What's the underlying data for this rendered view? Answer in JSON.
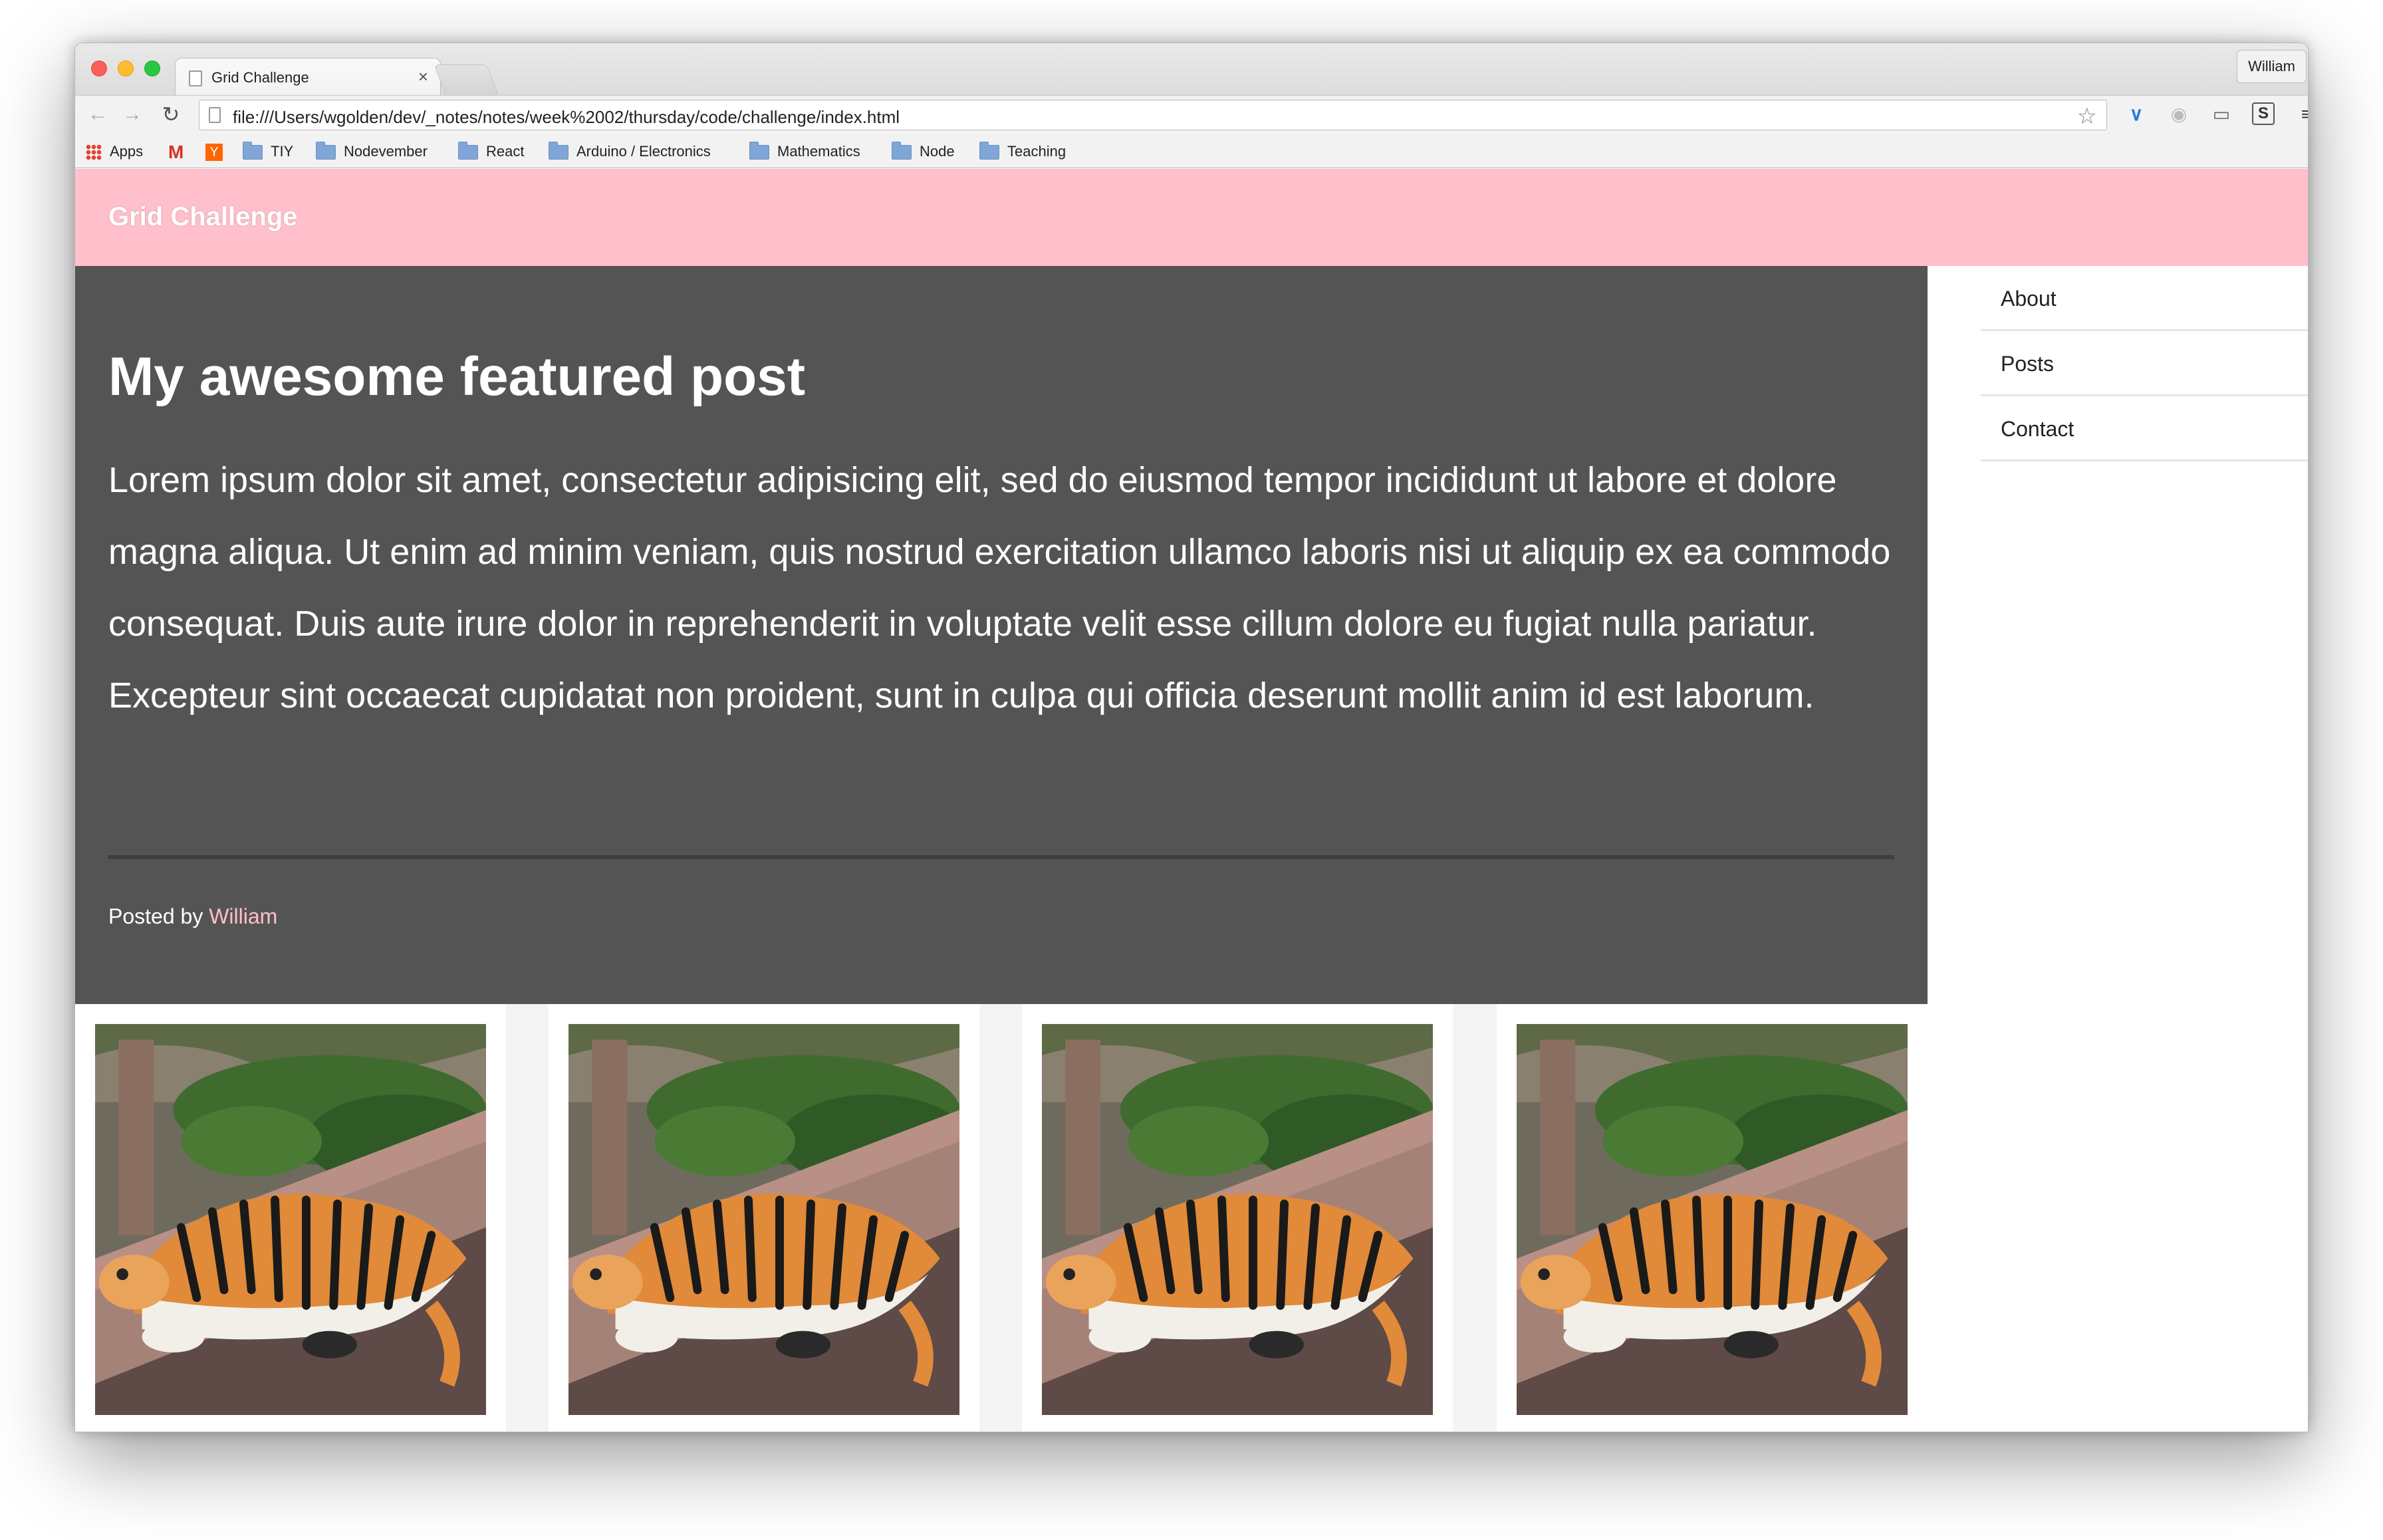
{
  "browser": {
    "tab_title": "Grid Challenge",
    "tab_close": "×",
    "profile_name": "William",
    "url": "file:///Users/wgolden/dev/_notes/notes/week%2002/thursday/code/challenge/index.html",
    "bookmarks": [
      {
        "label": "Apps",
        "icon": "apps-grid-icon"
      },
      {
        "label": "",
        "icon": "gmail-icon"
      },
      {
        "label": "",
        "icon": "ycombinator-icon"
      },
      {
        "label": "TIY",
        "icon": "folder-icon"
      },
      {
        "label": "Nodevember",
        "icon": "folder-icon"
      },
      {
        "label": "React",
        "icon": "folder-icon"
      },
      {
        "label": "Arduino / Electronics",
        "icon": "folder-icon"
      },
      {
        "label": "Mathematics",
        "icon": "folder-icon"
      },
      {
        "label": "Node",
        "icon": "folder-icon"
      },
      {
        "label": "Teaching",
        "icon": "folder-icon"
      }
    ]
  },
  "site": {
    "title": "Grid Challenge",
    "header_color": "#ffc0cb"
  },
  "featured": {
    "title": "My awesome featured post",
    "body": "Lorem ipsum dolor sit amet, consectetur adipisicing elit, sed do eiusmod tempor incididunt ut labore et dolore magna aliqua. Ut enim ad minim veniam, quis nostrud exercitation ullamco laboris nisi ut aliquip ex ea commodo consequat. Duis aute irure dolor in reprehenderit in voluptate velit esse cillum dolore eu fugiat nulla pariatur. Excepteur sint occaecat cupidatat non proident, sunt in culpa qui officia deserunt mollit anim id est laborum.",
    "posted_by_label": "Posted by",
    "author": "William",
    "background": "#555455"
  },
  "sidebar": {
    "items": [
      {
        "label": "About"
      },
      {
        "label": "Posts"
      },
      {
        "label": "Contact"
      }
    ]
  },
  "gallery": {
    "images": [
      {
        "subject": "tiger-image"
      },
      {
        "subject": "tiger-image"
      },
      {
        "subject": "tiger-image"
      },
      {
        "subject": "tiger-image"
      }
    ]
  }
}
